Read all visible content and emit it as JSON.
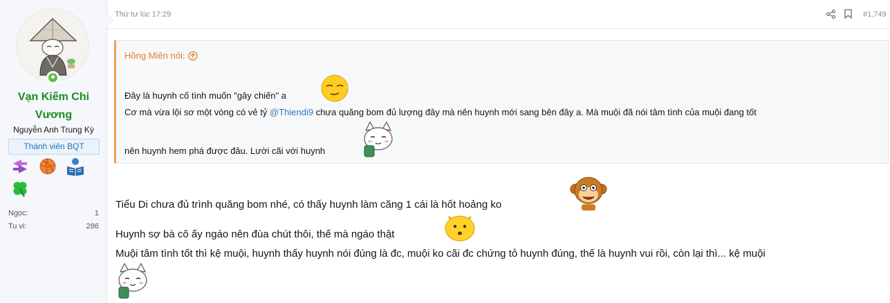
{
  "user": {
    "name_line1": "Vạn Kiếm Chi",
    "name_line2": "Vương",
    "title": "Nguyễn Anh Trung Kỳ",
    "banner": "Thành viên BQT",
    "stats": [
      {
        "label": "Ngọc:",
        "value": "1"
      },
      {
        "label": "Tu vi:",
        "value": "286"
      }
    ]
  },
  "post": {
    "date": "Thứ tư lúc 17:29",
    "number": "#1,749",
    "quote": {
      "author_label": "Hồng Miên nói:",
      "line1": "Đây là huynh cố tình muốn \"gây chiến\" a",
      "line2_before": "Cơ mà vừa lội sơ một vòng có vẻ tỷ ",
      "line2_mention": "@Thiendi9",
      "line2_after": " chưa quăng bom đủ lượng đây mà nên huynh mới sang bên đây a. Mà muội đã nói tâm tình của muội đang tốt",
      "line3": "nên huynh hem phá được đâu. Lười cãi với huynh"
    },
    "body": {
      "line1": "Tiểu Di chưa đủ trình quăng bom nhé, có thấy huynh làm căng 1 cái là hốt hoảng ko",
      "line2": "Huynh sợ bà cô ấy ngáo nên đùa chút thôi, thế mà ngáo thật",
      "line3": "Muội tâm tình tốt thì kệ muội, huynh thấy huynh nói đúng là đc, muội ko cãi đc chứng tỏ huynh đúng, thế là huynh vui rồi, còn lại thì... kệ muội"
    }
  },
  "colors": {
    "username": "#1d8a1d",
    "quote_accent": "#f0a058",
    "mention": "#2f75b5",
    "online": "#63b745"
  },
  "icons": [
    "avatar-image",
    "online-status-icon",
    "trophy-arrows-icon",
    "trophy-ball-icon",
    "trophy-book-icon",
    "trophy-clover-icon",
    "share-icon",
    "bookmark-icon",
    "quote-jump-icon",
    "emoticon-smug-face",
    "emoticon-cat-tea",
    "emoticon-monkey",
    "emoticon-yellow-blob"
  ]
}
